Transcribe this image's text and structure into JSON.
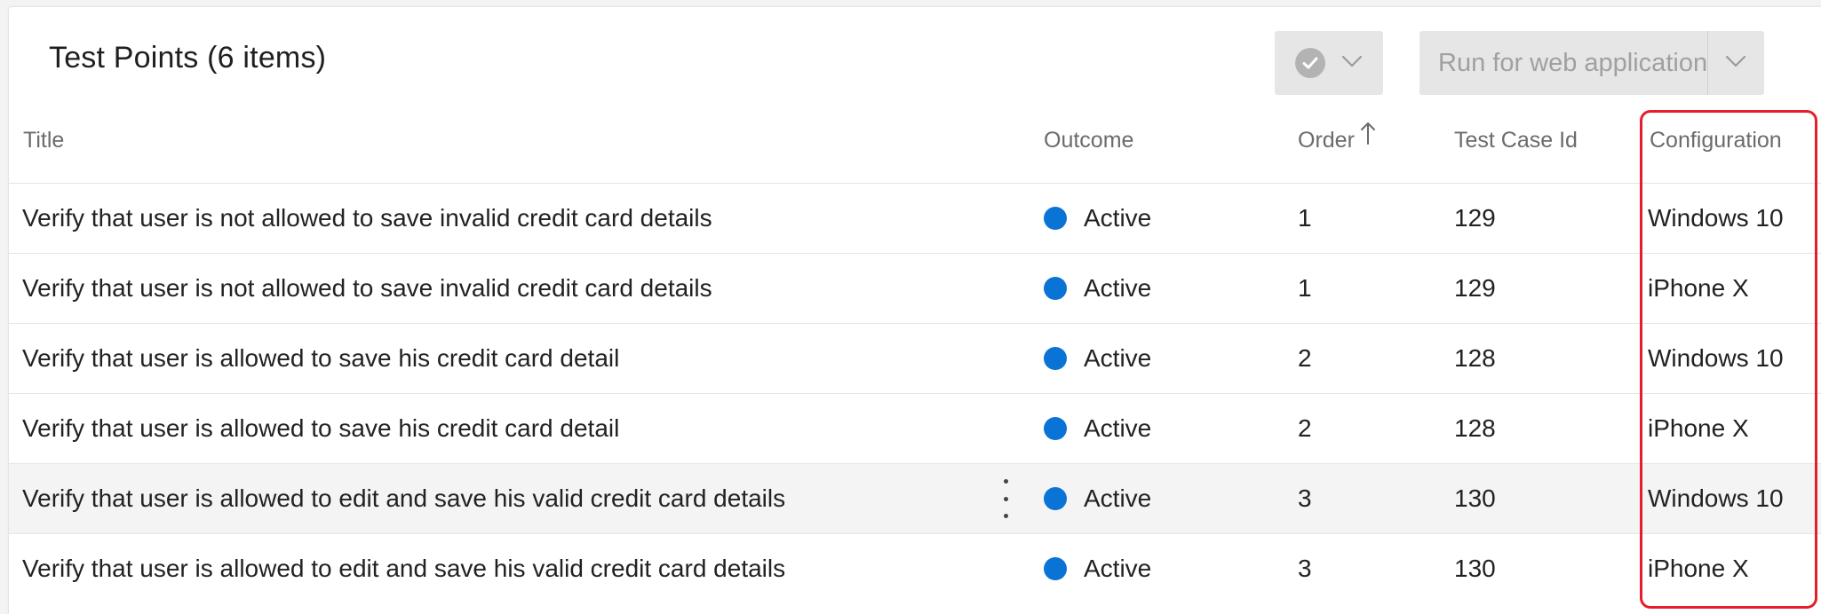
{
  "header": {
    "title": "Test Points (6 items)",
    "run_button_label": "Run for web application"
  },
  "columns": {
    "title": "Title",
    "outcome": "Outcome",
    "order": "Order",
    "test_case_id": "Test Case Id",
    "configuration": "Configuration"
  },
  "colors": {
    "active_dot": "#0a73d6",
    "highlight_border": "#e41e2a"
  },
  "rows": [
    {
      "title": "Verify that user is not allowed to save invalid credit card details",
      "outcome": "Active",
      "order": "1",
      "test_case_id": "129",
      "configuration": "Windows 10"
    },
    {
      "title": "Verify that user is not allowed to save invalid credit card details",
      "outcome": "Active",
      "order": "1",
      "test_case_id": "129",
      "configuration": "iPhone X"
    },
    {
      "title": "Verify that user is allowed to save his credit card detail",
      "outcome": "Active",
      "order": "2",
      "test_case_id": "128",
      "configuration": "Windows 10"
    },
    {
      "title": "Verify that user is allowed to save his credit card detail",
      "outcome": "Active",
      "order": "2",
      "test_case_id": "128",
      "configuration": "iPhone X"
    },
    {
      "title": "Verify that user is allowed to edit and save his valid credit card details",
      "outcome": "Active",
      "order": "3",
      "test_case_id": "130",
      "configuration": "Windows 10"
    },
    {
      "title": "Verify that user is allowed to edit and save his valid credit card details",
      "outcome": "Active",
      "order": "3",
      "test_case_id": "130",
      "configuration": "iPhone X"
    }
  ]
}
